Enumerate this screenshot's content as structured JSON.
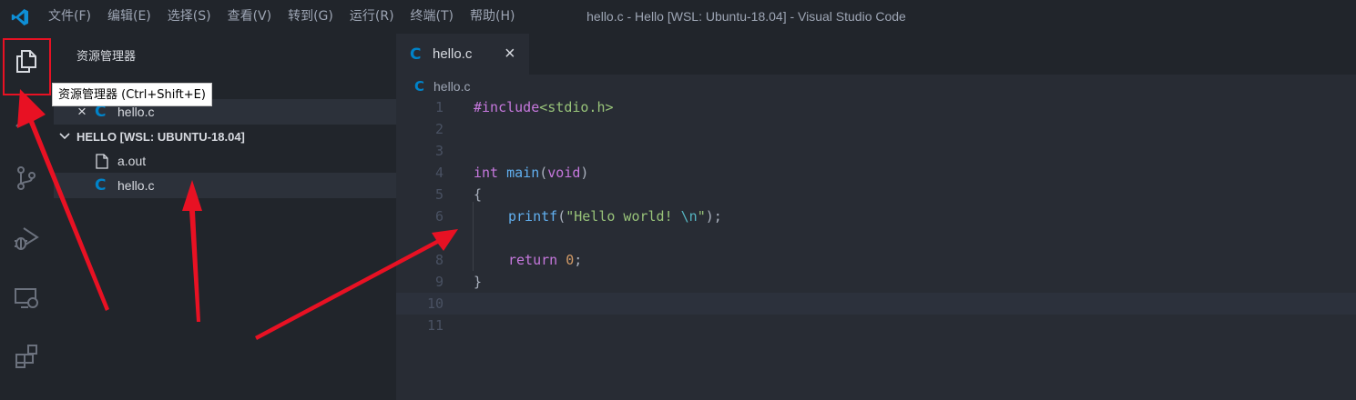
{
  "titlebar": {
    "menu": [
      "文件(F)",
      "编辑(E)",
      "选择(S)",
      "查看(V)",
      "转到(G)",
      "运行(R)",
      "终端(T)",
      "帮助(H)"
    ],
    "window_title": "hello.c - Hello [WSL: Ubuntu-18.04] - Visual Studio Code"
  },
  "activitybar": {
    "items": [
      "explorer-icon",
      "search-icon",
      "source-control-icon",
      "run-debug-icon",
      "remote-explorer-icon",
      "extensions-icon"
    ],
    "highlight_color": "#e81123"
  },
  "tooltip": {
    "text": "资源管理器 (Ctrl+Shift+E)"
  },
  "sidebar": {
    "title": "资源管理器",
    "open_editor": {
      "close": "×",
      "icon": "C",
      "name": "hello.c"
    },
    "folder": {
      "name": "HELLO [WSL: UBUNTU-18.04]"
    },
    "files": [
      {
        "name": "a.out",
        "icon": "file-icon"
      },
      {
        "name": "hello.c",
        "icon": "c-file-icon"
      }
    ]
  },
  "editor": {
    "tab": {
      "icon": "C",
      "label": "hello.c",
      "close": "×"
    },
    "breadcrumb": {
      "icon": "C",
      "label": "hello.c"
    },
    "line_numbers": [
      "1",
      "2",
      "3",
      "4",
      "5",
      "6",
      "7",
      "8",
      "9",
      "10",
      "11"
    ],
    "code": {
      "l1_pp": "#include",
      "l1_hdr": "<stdio.h>",
      "l4_type": "int",
      "l4_fn": "main",
      "l4_open": "(",
      "l4_void": "void",
      "l4_close": ")",
      "l5": "{",
      "l6_fn": "printf",
      "l6_open": "(",
      "l6_str": "\"Hello world! ",
      "l6_esc": "\\n",
      "l6_strend": "\"",
      "l6_end": ");",
      "l8_kw": "return",
      "l8_num": "0",
      "l8_end": ";",
      "l9": "}"
    }
  },
  "colors": {
    "accent": "#0083c9",
    "annotation_arrow": "#e81123"
  }
}
